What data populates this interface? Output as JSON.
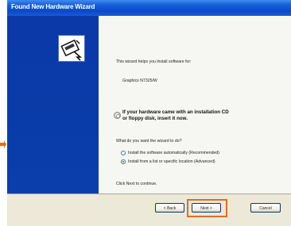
{
  "window": {
    "title": "Found New Hardware Wizard"
  },
  "icons": {
    "wizard": "hardware-wizard-icon",
    "cd": "cd-icon",
    "arrow": "pointer-arrow-icon"
  },
  "content": {
    "intro": "This wizard helps you install software for:",
    "device_name": "Graphics N7325/W",
    "cd_warning_line1": "If your hardware came with an installation CD",
    "cd_warning_line2": "or floppy disk, insert it now.",
    "question": "What do you want the wizard to do?",
    "option_auto": "Install the software automatically (Recommended)",
    "option_manual": "Install from a list or specific location (Advanced)",
    "continue_text": "Click Next to continue."
  },
  "selected_option": "option_manual",
  "buttons": {
    "back": "< Back",
    "next": "Next >",
    "cancel": "Cancel"
  },
  "colors": {
    "sidebar": "#0b3aa8",
    "titlebar": "#0a49c9",
    "highlight": "#e36c26"
  }
}
